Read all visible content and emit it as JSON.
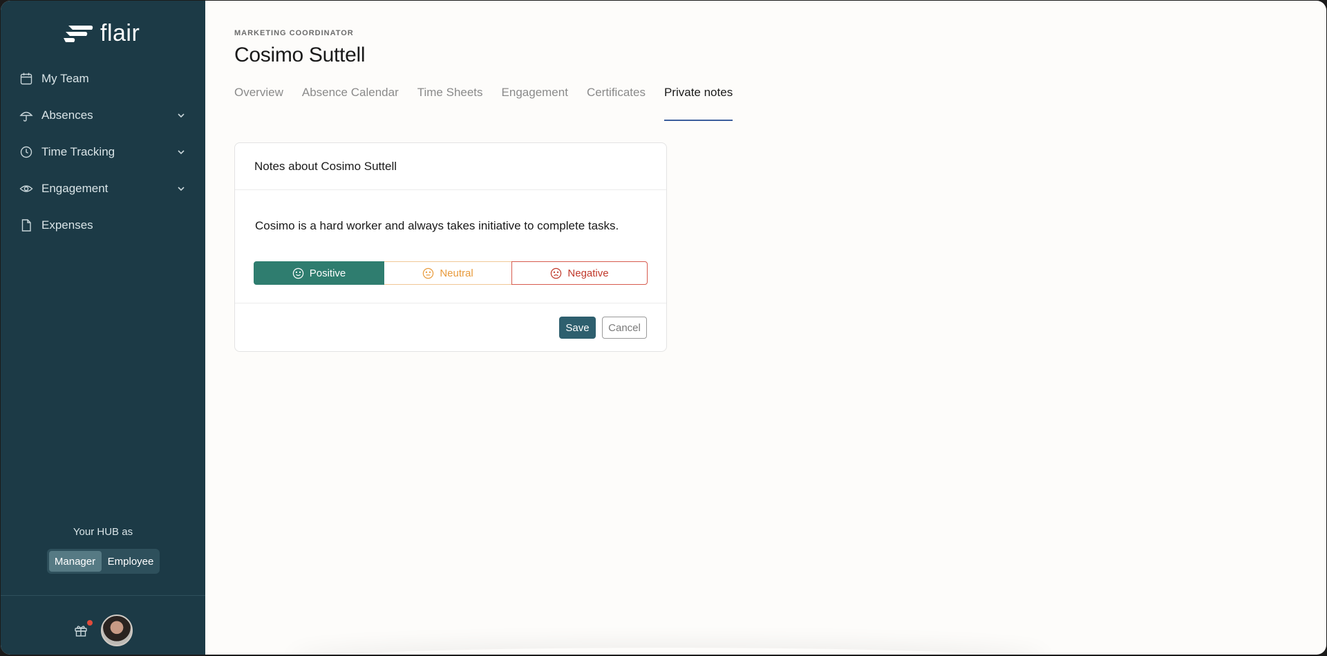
{
  "brand": {
    "name": "flair"
  },
  "sidebar": {
    "items": [
      {
        "label": "My Team",
        "icon": "calendar-icon",
        "expandable": false
      },
      {
        "label": "Absences",
        "icon": "umbrella-icon",
        "expandable": true
      },
      {
        "label": "Time Tracking",
        "icon": "clock-icon",
        "expandable": true
      },
      {
        "label": "Engagement",
        "icon": "eye-icon",
        "expandable": true
      },
      {
        "label": "Expenses",
        "icon": "document-icon",
        "expandable": false
      }
    ],
    "hub": {
      "label": "Your HUB as",
      "options": [
        "Manager",
        "Employee"
      ],
      "selected": "Manager"
    }
  },
  "header": {
    "role": "MARKETING COORDINATOR",
    "name": "Cosimo Suttell"
  },
  "tabs": [
    {
      "label": "Overview",
      "active": false
    },
    {
      "label": "Absence Calendar",
      "active": false
    },
    {
      "label": "Time Sheets",
      "active": false
    },
    {
      "label": "Engagement",
      "active": false
    },
    {
      "label": "Certificates",
      "active": false
    },
    {
      "label": "Private notes",
      "active": true
    }
  ],
  "note_card": {
    "title": "Notes about Cosimo Suttell",
    "text": "Cosimo is a hard worker and always takes initiative to complete tasks.",
    "sentiment": {
      "positive": "Positive",
      "neutral": "Neutral",
      "negative": "Negative",
      "selected": "Positive"
    },
    "save_label": "Save",
    "cancel_label": "Cancel"
  },
  "colors": {
    "sidebar_bg": "#1c3a46",
    "positive": "#2f7d6f",
    "neutral": "#e89a3b",
    "negative": "#c0392b",
    "save": "#2e5f6e",
    "tab_underline": "#3b5e9c"
  }
}
